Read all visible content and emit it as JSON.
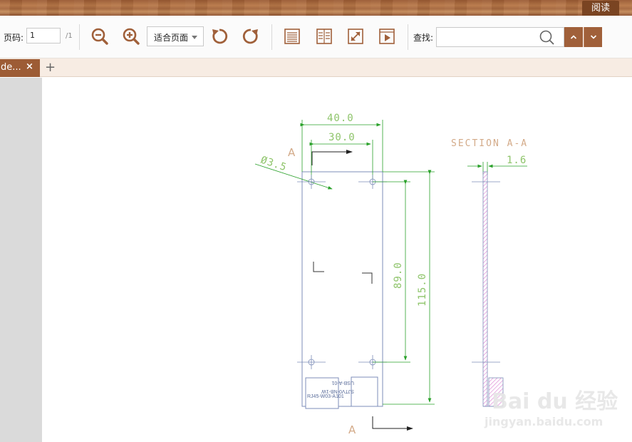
{
  "title_bar": {
    "read_tab": "阅读"
  },
  "toolbar": {
    "page_label": "页码:",
    "page_value": "1",
    "page_total": "/1",
    "fit_select": "适合页面",
    "find_label": "查找:",
    "find_value": ""
  },
  "tabs": {
    "doc_tab": "de...",
    "close": "×",
    "add": "+"
  },
  "drawing": {
    "dim_width_outer": "40.0",
    "dim_width_inner": "30.0",
    "dim_hole": "Ø3.5",
    "dim_height_inner": "89.0",
    "dim_height_outer": "115.0",
    "section_title": "SECTION A-A",
    "dim_thickness": "1.6",
    "section_mark_top": "A",
    "section_mark_bottom": "A",
    "component_rj45": "RJ45-W03-A101",
    "component_usb_a": "USB-A-01",
    "component_usb_b": "SJTV0-NB-1W"
  },
  "watermark": {
    "logo": "Bai du 经验",
    "url": "jingyan.baidu.com"
  },
  "colors": {
    "accent": "#9d5c35",
    "dimension": "#2aa12a",
    "outline": "#7d8db8",
    "section_text": "#d3aa88"
  }
}
